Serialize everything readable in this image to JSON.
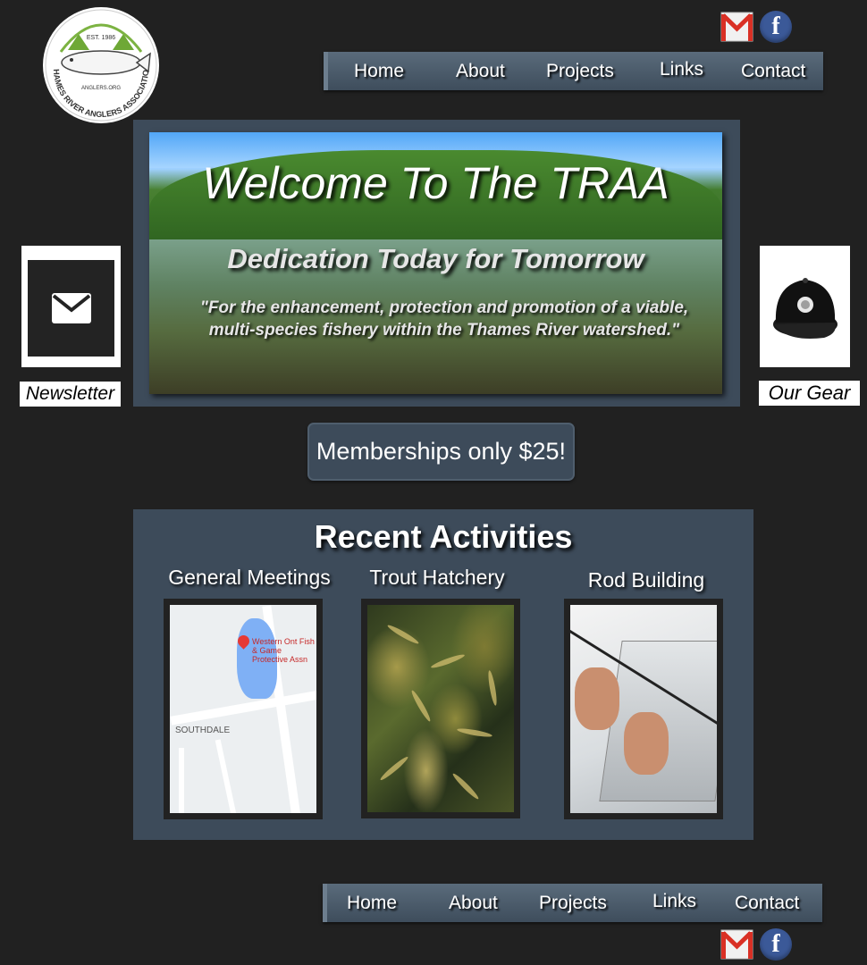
{
  "logo": {
    "est": "EST. 1986",
    "domain": "ANGLERS.ORG",
    "org_name": "THAMES RIVER ANGLERS ASSOCIATION"
  },
  "nav": {
    "items": [
      "Home",
      "About",
      "Projects",
      "Links",
      "Contact"
    ]
  },
  "hero": {
    "title": "Welcome To The TRAA",
    "subtitle": "Dedication Today for Tomorrow",
    "mission": "\"For the enhancement, protection and promotion of a viable, multi-species fishery within the Thames River watershed.\""
  },
  "sidebar": {
    "newsletter_label": "Newsletter",
    "gear_label": "Our Gear"
  },
  "membership": {
    "label": "Memberships only $25!"
  },
  "activities": {
    "heading": "Recent Activities",
    "items": [
      {
        "title": "General Meetings",
        "map_pin_label": "Western Ont Fish & Game Protective Assn",
        "map_area_label": "SOUTHDALE"
      },
      {
        "title": "Trout Hatchery"
      },
      {
        "title": "Rod Building"
      }
    ]
  },
  "colors": {
    "background": "#212121",
    "panel": "#3d4b5a",
    "nav_bar": "#4a5a6a",
    "facebook": "#3b5998",
    "gmail_red": "#d93025"
  },
  "icons": {
    "gmail": "gmail-icon",
    "facebook": "facebook-icon",
    "newsletter": "envelope-icon",
    "gear": "cap-icon"
  }
}
